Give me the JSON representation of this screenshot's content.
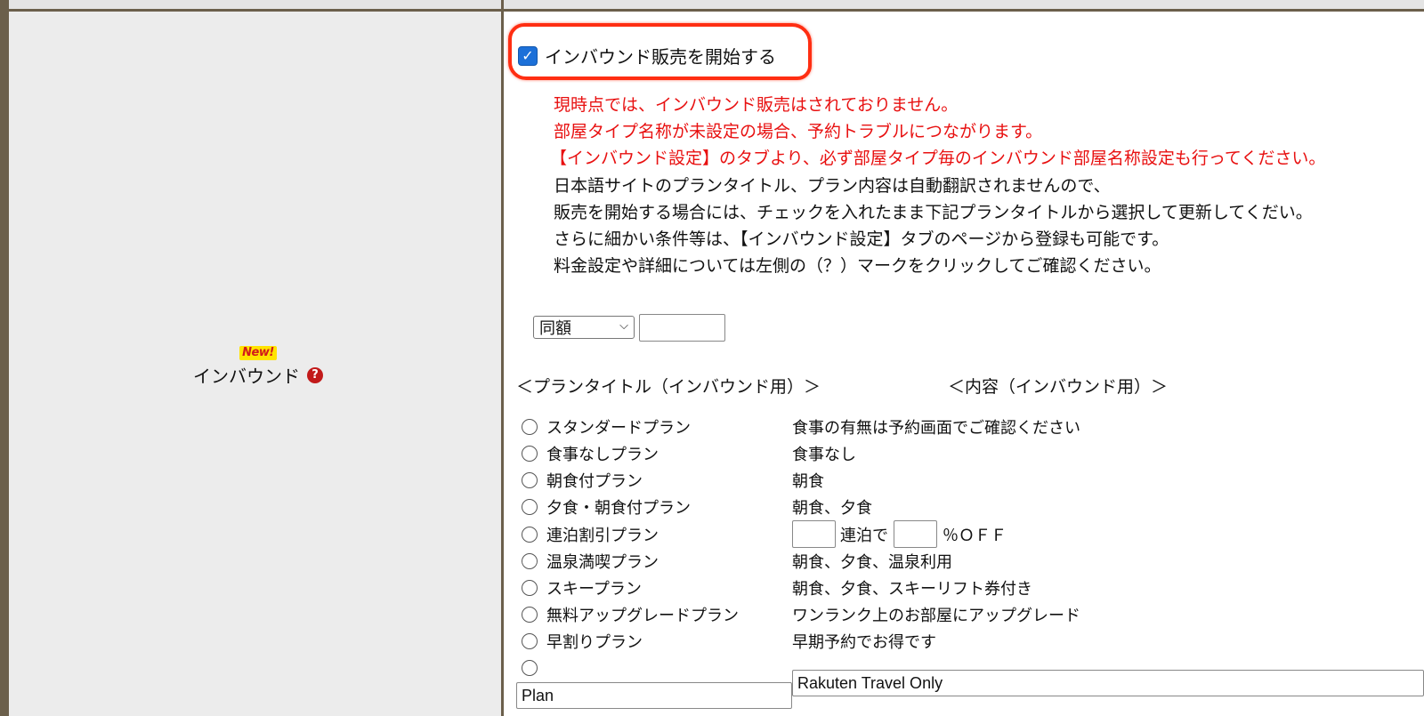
{
  "label": {
    "new_badge": "New!",
    "title": "インバウンド",
    "help_icon": "help-circle-icon"
  },
  "start_sale": {
    "checked": true,
    "label": "インバウンド販売を開始する"
  },
  "notices": {
    "red": [
      "現時点では、インバウンド販売はされておりません。",
      "部屋タイプ名称が未設定の場合、予約トラブルにつながります。",
      "【インバウンド設定】のタブより、必ず部屋タイプ毎のインバウンド部屋名称設定も行ってください。"
    ],
    "black": [
      "日本語サイトのプランタイトル、プラン内容は自動翻訳されませんので、",
      "販売を開始する場合には、チェックを入れたまま下記プランタイトルから選択して更新してくだい。",
      "さらに細かい条件等は、【インバウンド設定】タブのページから登録も可能です。",
      "料金設定や詳細については左側の（？）マークをクリックしてご確認ください。"
    ]
  },
  "price": {
    "select_value": "同額",
    "amount_value": ""
  },
  "headers": {
    "plan_title": "＜プランタイトル（インバウンド用）＞",
    "content": "＜内容（インバウンド用）＞"
  },
  "plans": [
    {
      "title": "スタンダードプラン",
      "content": "食事の有無は予約画面でご確認ください"
    },
    {
      "title": "食事なしプラン",
      "content": "食事なし"
    },
    {
      "title": "朝食付プラン",
      "content": "朝食"
    },
    {
      "title": "夕食・朝食付プラン",
      "content": "朝食、夕食"
    },
    {
      "title": "連泊割引プラン",
      "content_mid": "連泊で",
      "content_end": "％ＯＦＦ"
    },
    {
      "title": "温泉満喫プラン",
      "content": "朝食、夕食、温泉利用"
    },
    {
      "title": "スキープラン",
      "content": "朝食、夕食、スキーリフト券付き"
    },
    {
      "title": "無料アップグレードプラン",
      "content": "ワンランク上のお部屋にアップグレード"
    },
    {
      "title": "早割りプラン",
      "content": "早期予約でお得です"
    }
  ],
  "custom_plan": {
    "title_value": "Plan",
    "content_value": "Rakuten Travel Only"
  }
}
